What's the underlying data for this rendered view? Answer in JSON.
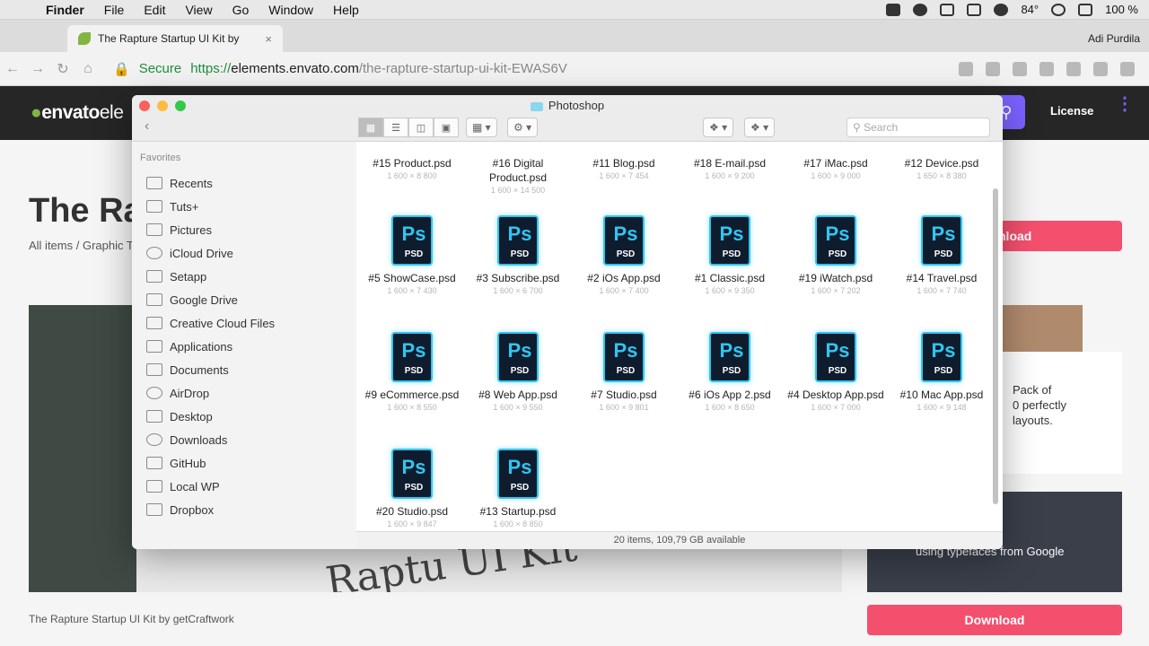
{
  "menubar": {
    "apple": "",
    "app": "Finder",
    "items": [
      "File",
      "Edit",
      "View",
      "Go",
      "Window",
      "Help"
    ],
    "temperature": "84°",
    "battery": "100 %"
  },
  "browser": {
    "tab_title": "The Rapture Startup UI Kit by",
    "tab_close": "×",
    "profile": "Adi Purdila",
    "secure_label": "Secure",
    "url_proto": "https://",
    "url_host": "elements.envato.com",
    "url_rest": "/the-rapture-startup-ui-kit-EWAS6V"
  },
  "site": {
    "logo_brand": "envato",
    "logo_suffix": "ele",
    "license": "License",
    "title": "The Ra",
    "breadcrumbs": "All items / Graphic T",
    "download_top": "nload",
    "hero_text": "Raptu   UI Kit",
    "caption_prefix": "The Rapture Startup UI Kit by",
    "caption_author": "getCraftwork",
    "promo_text": "Pack of\n0 perfectly\nlayouts.",
    "thumb2_text": "een designed\nusing typefaces from Google",
    "download_bottom": "Download"
  },
  "finder": {
    "title": "Photoshop",
    "search_placeholder": "Search",
    "sidebar_header": "Favorites",
    "sidebar_items": [
      "Recents",
      "Tuts+",
      "Pictures",
      "iCloud Drive",
      "Setapp",
      "Google Drive",
      "Creative Cloud Files",
      "Applications",
      "Documents",
      "AirDrop",
      "Desktop",
      "Downloads",
      "GitHub",
      "Local WP",
      "Dropbox"
    ],
    "files": [
      {
        "name": "#15 Product.psd",
        "size": "1 600 × 8 800"
      },
      {
        "name": "#16 Digital Product.psd",
        "size": "1 600 × 14 500"
      },
      {
        "name": "#11 Blog.psd",
        "size": "1 600 × 7 454"
      },
      {
        "name": "#18 E-mail.psd",
        "size": "1 600 × 9 200"
      },
      {
        "name": "#17 iMac.psd",
        "size": "1 600 × 9 000"
      },
      {
        "name": "#12 Device.psd",
        "size": "1 650 × 8 380"
      },
      {
        "name": "#5 ShowCase.psd",
        "size": "1 600 × 7 430"
      },
      {
        "name": "#3 Subscribe.psd",
        "size": "1 600 × 6 700"
      },
      {
        "name": "#2 iOs App.psd",
        "size": "1 600 × 7 400"
      },
      {
        "name": "#1 Classic.psd",
        "size": "1 600 × 9 350"
      },
      {
        "name": "#19 iWatch.psd",
        "size": "1 600 × 7 202"
      },
      {
        "name": "#14 Travel.psd",
        "size": "1 600 × 7 740"
      },
      {
        "name": "#9 eCommerce.psd",
        "size": "1 600 × 8 550"
      },
      {
        "name": "#8 Web App.psd",
        "size": "1 600 × 9 550"
      },
      {
        "name": "#7 Studio.psd",
        "size": "1 600 × 9 801"
      },
      {
        "name": "#6 iOs App 2.psd",
        "size": "1 600 × 8 650"
      },
      {
        "name": "#4 Desktop App.psd",
        "size": "1 600 × 7 000"
      },
      {
        "name": "#10 Mac App.psd",
        "size": "1 600 × 9 148"
      },
      {
        "name": "#20 Studio.psd",
        "size": "1 600 × 9 847"
      },
      {
        "name": "#13 Startup.psd",
        "size": "1 600 × 8 850"
      }
    ],
    "icon_ps": "Ps",
    "icon_psd": "PSD",
    "status": "20 items, 109,79 GB available"
  }
}
